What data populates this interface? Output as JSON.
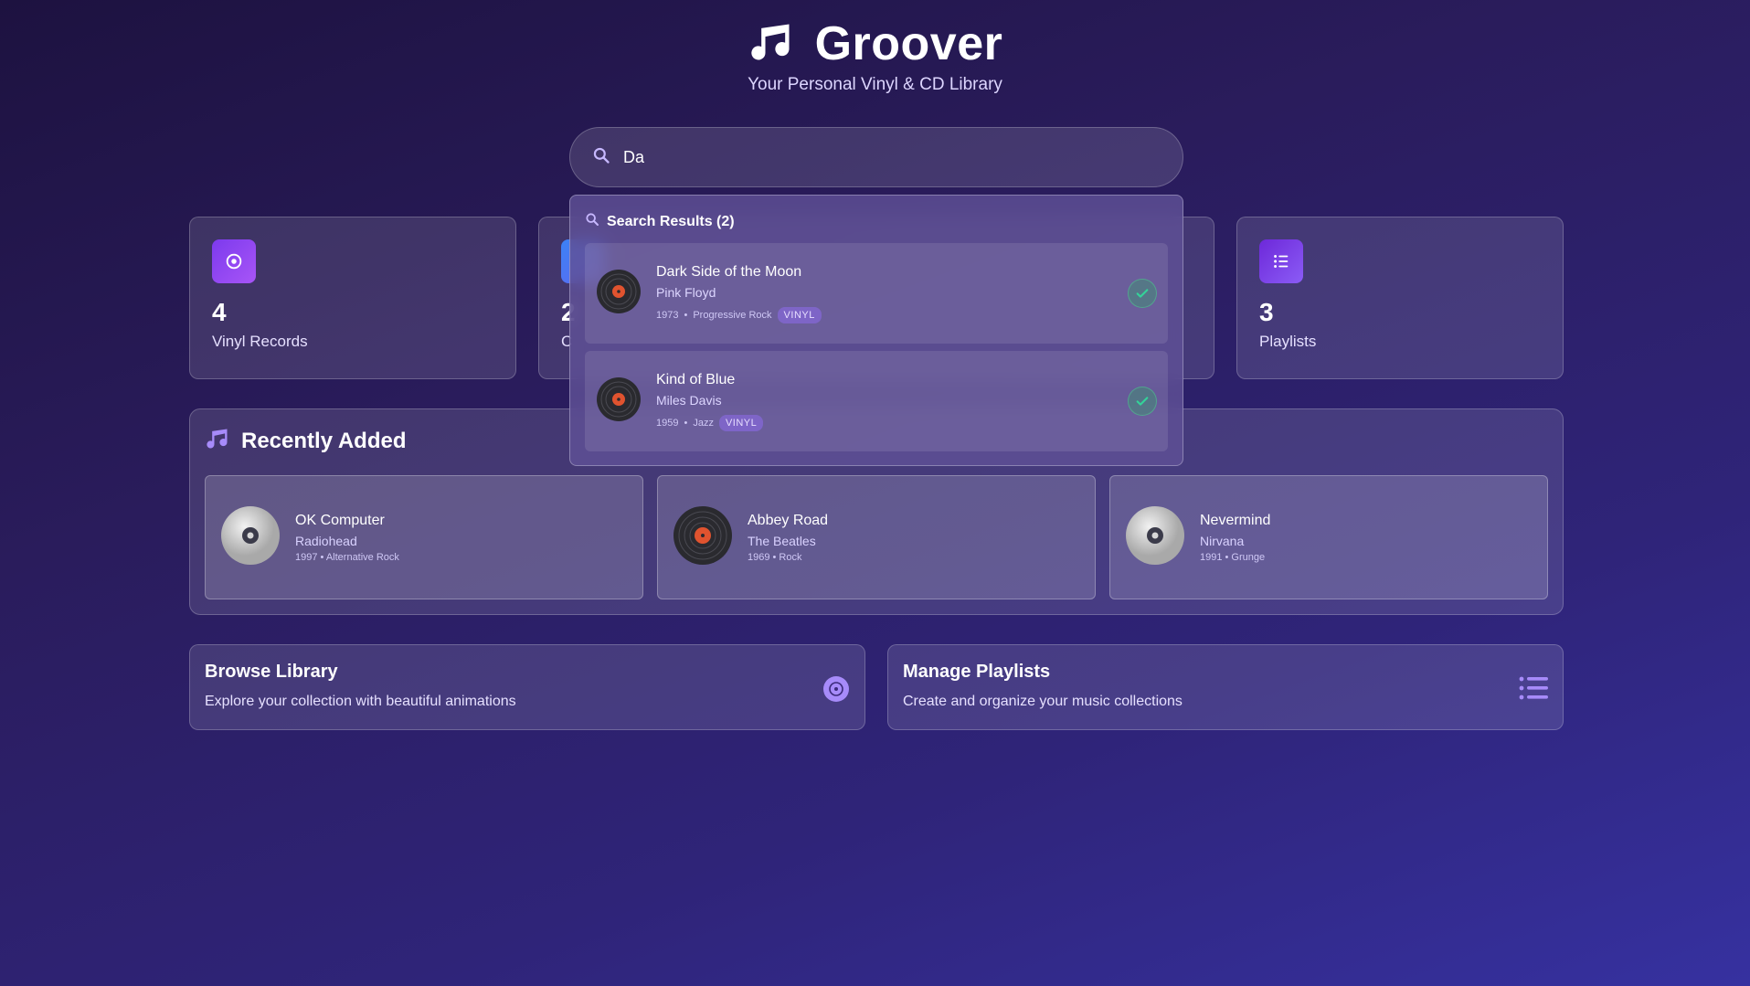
{
  "header": {
    "title": "Groover",
    "subtitle": "Your Personal Vinyl & CD Library"
  },
  "search": {
    "value": "Da",
    "placeholder": ""
  },
  "stats": [
    {
      "number": "4",
      "label": "Vinyl Records",
      "icon": "disc-icon"
    },
    {
      "number": "2",
      "label": "C",
      "icon": "cd-icon"
    },
    {
      "number": "3",
      "label": "Playlists",
      "icon": "list-icon"
    }
  ],
  "recently_added": {
    "title": "Recently Added",
    "albums": [
      {
        "title": "OK Computer",
        "artist": "Radiohead",
        "meta": "1997 • Alternative Rock",
        "format": "cd"
      },
      {
        "title": "Abbey Road",
        "artist": "The Beatles",
        "meta": "1969 • Rock",
        "format": "vinyl"
      },
      {
        "title": "Nevermind",
        "artist": "Nirvana",
        "meta": "1991 • Grunge",
        "format": "cd"
      }
    ]
  },
  "actions": {
    "browse": {
      "title": "Browse Library",
      "desc": "Explore your collection with beautiful animations"
    },
    "playlists": {
      "title": "Manage Playlists",
      "desc": "Create and organize your music collections"
    }
  },
  "search_results": {
    "title": "Search Results (2)",
    "results": [
      {
        "title": "Dark Side of the Moon",
        "artist": "Pink Floyd",
        "year": "1973",
        "genre": "Progressive Rock",
        "format": "VINYL"
      },
      {
        "title": "Kind of Blue",
        "artist": "Miles Davis",
        "year": "1959",
        "genre": "Jazz",
        "format": "VINYL"
      }
    ]
  },
  "colors": {
    "accent": "#8b5cf6",
    "vinyl_label": "#e0532f",
    "check": "#34d399"
  }
}
